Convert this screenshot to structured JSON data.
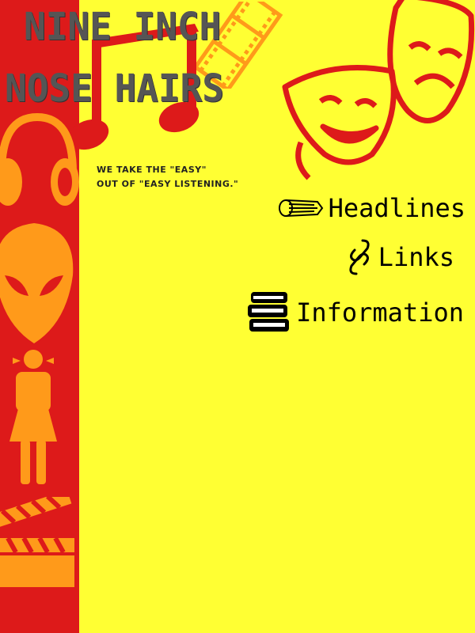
{
  "header": {
    "title_line_1": "NINE INCH",
    "title_line_2": "NOSE HAIRS"
  },
  "tagline": {
    "line_1": "WE TAKE THE \"EASY\"",
    "line_2": "OUT OF \"EASY LISTENING.\""
  },
  "nav": {
    "items": [
      {
        "label": "Headlines",
        "icon": "newspaper-icon"
      },
      {
        "label": "Links",
        "icon": "chain-link-icon"
      },
      {
        "label": "Information",
        "icon": "books-icon"
      }
    ]
  },
  "decorations": {
    "music_note": "music-note-icon",
    "film_strip": "film-strip-icon",
    "theater_masks": "theater-masks-icon",
    "headphones": "headphones-icon",
    "alien": "alien-icon",
    "girl": "girl-figure-icon",
    "clapperboard": "clapperboard-icon"
  },
  "colors": {
    "background": "#ffff33",
    "sidebar": "#dd1a1a",
    "orange_icons": "#ff9a1a",
    "red_decor": "#dd1a1a",
    "title_gray": "#555555",
    "nav_text": "#000000"
  }
}
